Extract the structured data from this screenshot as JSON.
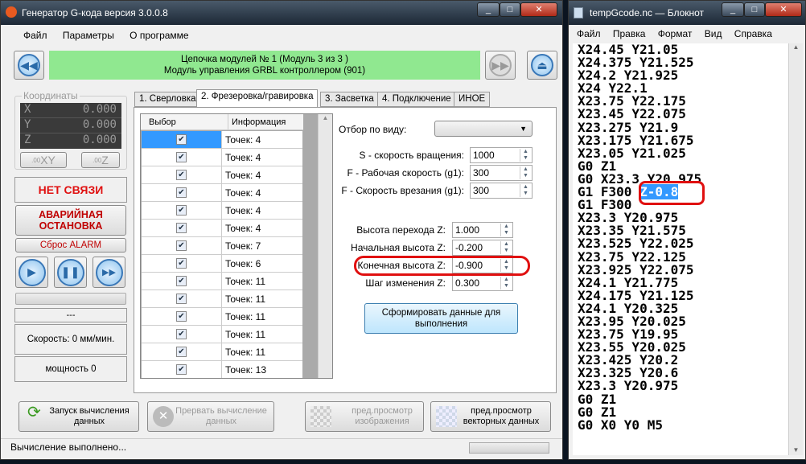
{
  "main_window": {
    "title": "Генератор G-кода версия 3.0.0.8",
    "menu": [
      "Файл",
      "Параметры",
      "О программе"
    ],
    "banner": {
      "line1": "Цепочка модулей № 1 (Модуль 3 из 3 )",
      "line2": "Модуль управления GRBL контроллером (901)"
    },
    "coords": {
      "title": "Координаты",
      "axes": [
        {
          "axis": "X",
          "value": "0.000"
        },
        {
          "axis": "Y",
          "value": "0.000"
        },
        {
          "axis": "Z",
          "value": "0.000"
        }
      ],
      "zero_xy": "XY",
      "zero_z": "Z",
      "zero_prefix": ".00"
    },
    "no_connection": "НЕТ СВЯЗИ",
    "emergency": "АВАРИЙНАЯ ОСТАНОВКА",
    "reset_alarm": "Сброс ALARM",
    "status_dash": "---",
    "speed": "Скорость: 0 мм/мин.",
    "power": "мощность 0",
    "tabs": [
      "1. Сверловка",
      "2. Фрезеровка/гравировка",
      "3. Засветка",
      "4. Подключение",
      "ИНОЕ"
    ],
    "active_tab": 1,
    "table": {
      "headers": [
        "Выбор",
        "Информация"
      ],
      "rows": [
        "Точек: 4",
        "Точек: 4",
        "Точек: 4",
        "Точек: 4",
        "Точек: 4",
        "Точек: 4",
        "Точек: 7",
        "Точек: 6",
        "Точек: 11",
        "Точек: 11",
        "Точек: 11",
        "Точек: 11",
        "Точек: 11",
        "Точек: 13"
      ]
    },
    "filter_label": "Отбор по виду:",
    "filter_value": "",
    "fields": [
      {
        "label": "S - скорость вращения:",
        "value": "1000"
      },
      {
        "label": "F - Рабочая скорость (g1):",
        "value": "300"
      },
      {
        "label": "F - Скорость врезания (g1):",
        "value": "300"
      }
    ],
    "z_fields": [
      {
        "label": "Высота перехода Z:",
        "value": "1.000"
      },
      {
        "label": "Начальная высота Z:",
        "value": "-0.200"
      },
      {
        "label": "Конечная высота Z:",
        "value": "-0.900"
      },
      {
        "label": "Шаг изменения Z:",
        "value": "0.300"
      }
    ],
    "generate_btn": "Сформировать данные для выполнения",
    "bottom": {
      "run": "Запуск вычисления данных",
      "abort": "Прервать вычисление данных",
      "preview_img": "пред.просмотр изображения",
      "preview_vec": "пред.просмотр векторных данных"
    },
    "status": "Вычисление выполнено...",
    "highlight_color": "#e01010"
  },
  "notepad": {
    "title": "tempGcode.nc — Блокнот",
    "menu": [
      "Файл",
      "Правка",
      "Формат",
      "Вид",
      "Справка"
    ],
    "lines": [
      "X24.45 Y21.05",
      "X24.375 Y21.525",
      "X24.2 Y21.925",
      "X24 Y22.1",
      "X23.75 Y22.175",
      "X23.45 Y22.075",
      "X23.275 Y21.9",
      "X23.175 Y21.675",
      "X23.05 Y21.025",
      "G0 Z1",
      "G0 X23.3 Y20.975",
      "G1 F300 ",
      "G1 F300",
      "X23.3 Y20.975",
      "X23.35 Y21.575",
      "X23.525 Y22.025",
      "X23.75 Y22.125",
      "X23.925 Y22.075",
      "X24.1 Y21.775",
      "X24.175 Y21.125",
      "X24.1 Y20.325",
      "X23.95 Y20.025",
      "X23.75 Y19.95",
      "X23.55 Y20.025",
      "X23.425 Y20.2",
      "X23.325 Y20.6",
      "X23.3 Y20.975",
      "G0 Z1",
      "G0 Z1",
      "G0 X0 Y0 M5"
    ],
    "selected_text": "Z-0.8"
  }
}
